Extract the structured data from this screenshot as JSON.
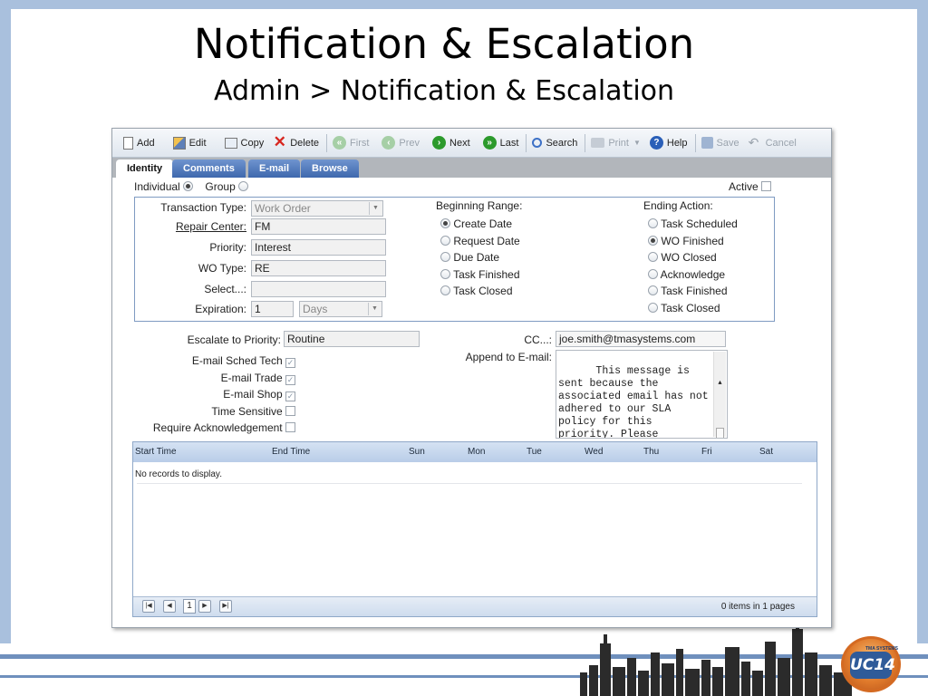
{
  "slide": {
    "title": "Notification & Escalation",
    "subtitle": "Admin > Notification & Escalation",
    "logo_text": "UC14",
    "logo_small": "TMA SYSTEMS"
  },
  "toolbar": {
    "add": "Add",
    "edit": "Edit",
    "copy": "Copy",
    "delete": "Delete",
    "first": "First",
    "prev": "Prev",
    "next": "Next",
    "last": "Last",
    "search": "Search",
    "print": "Print",
    "help": "Help",
    "save": "Save",
    "cancel": "Cancel"
  },
  "tabs": [
    "Identity",
    "Comments",
    "E-mail",
    "Browse"
  ],
  "form": {
    "individual_label": "Individual",
    "group_label": "Group",
    "active_label": "Active",
    "transaction_type_label": "Transaction Type:",
    "transaction_type_value": "Work Order",
    "repair_center_label": "Repair Center:",
    "repair_center_value": "FM",
    "priority_label": "Priority:",
    "priority_value": "Interest",
    "wo_type_label": "WO Type:",
    "wo_type_value": "RE",
    "select_label": "Select...:",
    "select_value": "",
    "expiration_label": "Expiration:",
    "expiration_value": "1",
    "expiration_unit": "Days",
    "beginning_range_label": "Beginning Range:",
    "beginning_range_options": [
      "Create Date",
      "Request Date",
      "Due Date",
      "Task Finished",
      "Task Closed"
    ],
    "ending_action_label": "Ending Action:",
    "ending_action_options": [
      "Task Scheduled",
      "WO Finished",
      "WO Closed",
      "Acknowledge",
      "Task Finished",
      "Task Closed"
    ],
    "escalate_label": "Escalate to Priority:",
    "escalate_value": "Routine",
    "email_sched_tech_label": "E-mail Sched Tech",
    "email_trade_label": "E-mail Trade",
    "email_shop_label": "E-mail Shop",
    "time_sensitive_label": "Time Sensitive",
    "require_ack_label": "Require Acknowledgement",
    "cc_label": "CC...:",
    "cc_value": "joe.smith@tmasystems.com",
    "append_label": "Append to E-mail:",
    "append_value": "This message is sent because the associated email has not adhered to our SLA policy for this priority. Please communicate with the"
  },
  "grid": {
    "columns": [
      "Start Time",
      "End Time",
      "Sun",
      "Mon",
      "Tue",
      "Wed",
      "Thu",
      "Fri",
      "Sat"
    ],
    "empty_text": "No records to display.",
    "page_number": "1",
    "page_info": "0 items in 1 pages"
  }
}
